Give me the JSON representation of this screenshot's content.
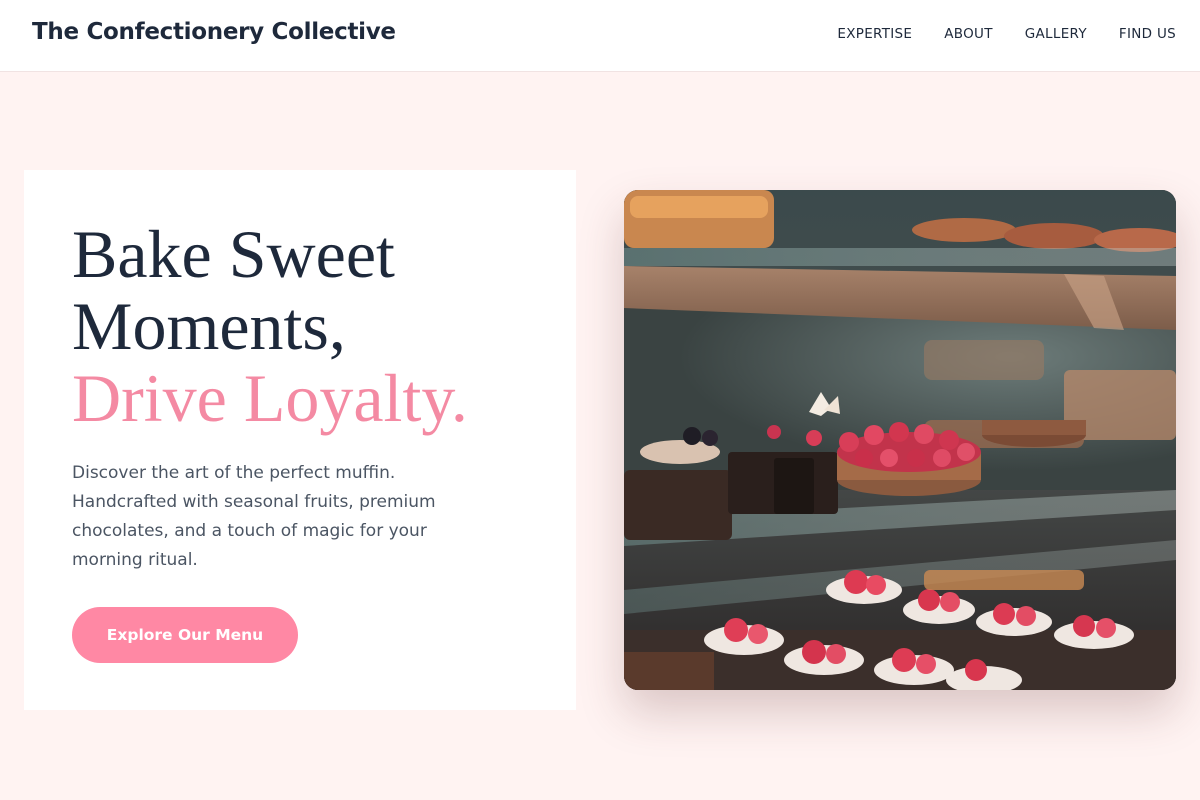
{
  "header": {
    "brand": "The Confectionery Collective",
    "nav": [
      {
        "label": "EXPERTISE"
      },
      {
        "label": "ABOUT"
      },
      {
        "label": "GALLERY"
      },
      {
        "label": "FIND US"
      }
    ]
  },
  "hero": {
    "headline_line1": "Bake Sweet",
    "headline_line2": "Moments,",
    "headline_accent": "Drive Loyalty.",
    "description": "Discover the art of the perfect muffin. Handcrafted with seasonal fruits, premium chocolates, and a touch of magic for your morning ritual.",
    "cta_label": "Explore Our Menu"
  },
  "image": {
    "subject": "pastry-display-case-photo"
  },
  "colors": {
    "page_background": "#fff3f2",
    "accent_pink": "#f48aa3",
    "button_pink": "#ff88a4",
    "heading_dark": "#1e293b",
    "body_text": "#4b5563"
  }
}
